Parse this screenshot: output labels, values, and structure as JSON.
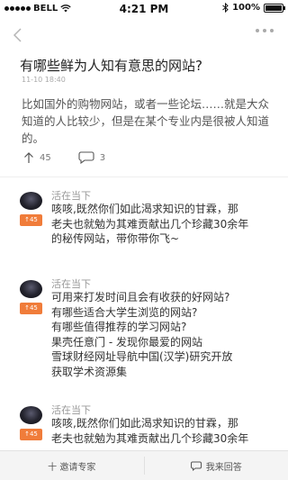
{
  "status_bar": {
    "carrier": "BELL",
    "time": "4:21 PM",
    "battery": "100%",
    "battery_level": 1.0
  },
  "question": {
    "title": "有哪些鲜为人知有意思的网站?",
    "date": "11-10 18:40",
    "body": "比如国外的购物网站，或者一些论坛……就是大众知道的人比较少，但是在某个专业内是很被人知道的。",
    "likes": "45",
    "comments": "3"
  },
  "answers": [
    {
      "author": "活在当下",
      "votes": "45",
      "lines": [
        "咳咳,既然你们如此渴求知识的甘霖，那",
        "老夫也就勉为其难贡献出几个珍藏30余年",
        "的秘传网站，带你带你飞~"
      ]
    },
    {
      "author": "活在当下",
      "votes": "45",
      "lines": [
        "可用来打发时间且会有收获的好网站?",
        "有哪些适合大学生浏览的网站?",
        "有哪些值得推荐的学习网站?",
        "果壳任意门 - 发现你最爱的网站",
        "雪球财经网址导航中国(汉学)研究开放",
        "获取学术资源集"
      ]
    },
    {
      "author": "活在当下",
      "votes": "45",
      "lines": [
        "咳咳,既然你们如此渴求知识的甘霖，那",
        "老夫也就勉为其难贡献出几个珍藏30余年"
      ]
    }
  ],
  "bottom_bar": {
    "invite_label": "十 邀请专家",
    "answer_label": "我来回答"
  },
  "colors": {
    "accent": "#f07c3a",
    "text": "#333333",
    "muted": "#999999"
  },
  "icons": [
    "back-chevron-icon",
    "more-dots-icon",
    "thumbs-up-icon",
    "comment-bubble-icon",
    "answer-bubble-icon",
    "wifi-icon",
    "bluetooth-icon",
    "battery-icon"
  ]
}
